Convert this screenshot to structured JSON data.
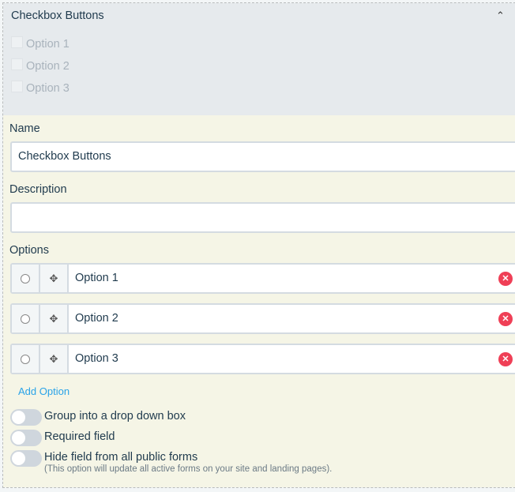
{
  "header": {
    "title": "Checkbox Buttons",
    "preview_options": [
      "Option 1",
      "Option 2",
      "Option 3"
    ]
  },
  "form": {
    "name_label": "Name",
    "name_value": "Checkbox Buttons",
    "description_label": "Description",
    "description_value": "",
    "options_label": "Options",
    "options": [
      "Option 1",
      "Option 2",
      "Option 3"
    ],
    "add_option": "Add Option",
    "toggles": [
      {
        "label": "Group into a drop down box",
        "on": false
      },
      {
        "label": "Required field",
        "on": false
      },
      {
        "label": "Hide field from all public forms",
        "on": false
      }
    ],
    "hide_note": "(This option will update all active forms on your site and landing pages)."
  },
  "colors": {
    "delete": "#ef3f56",
    "link": "#29a3e8",
    "header_bg": "#e6eaed",
    "body_bg": "#f5f5e6"
  }
}
